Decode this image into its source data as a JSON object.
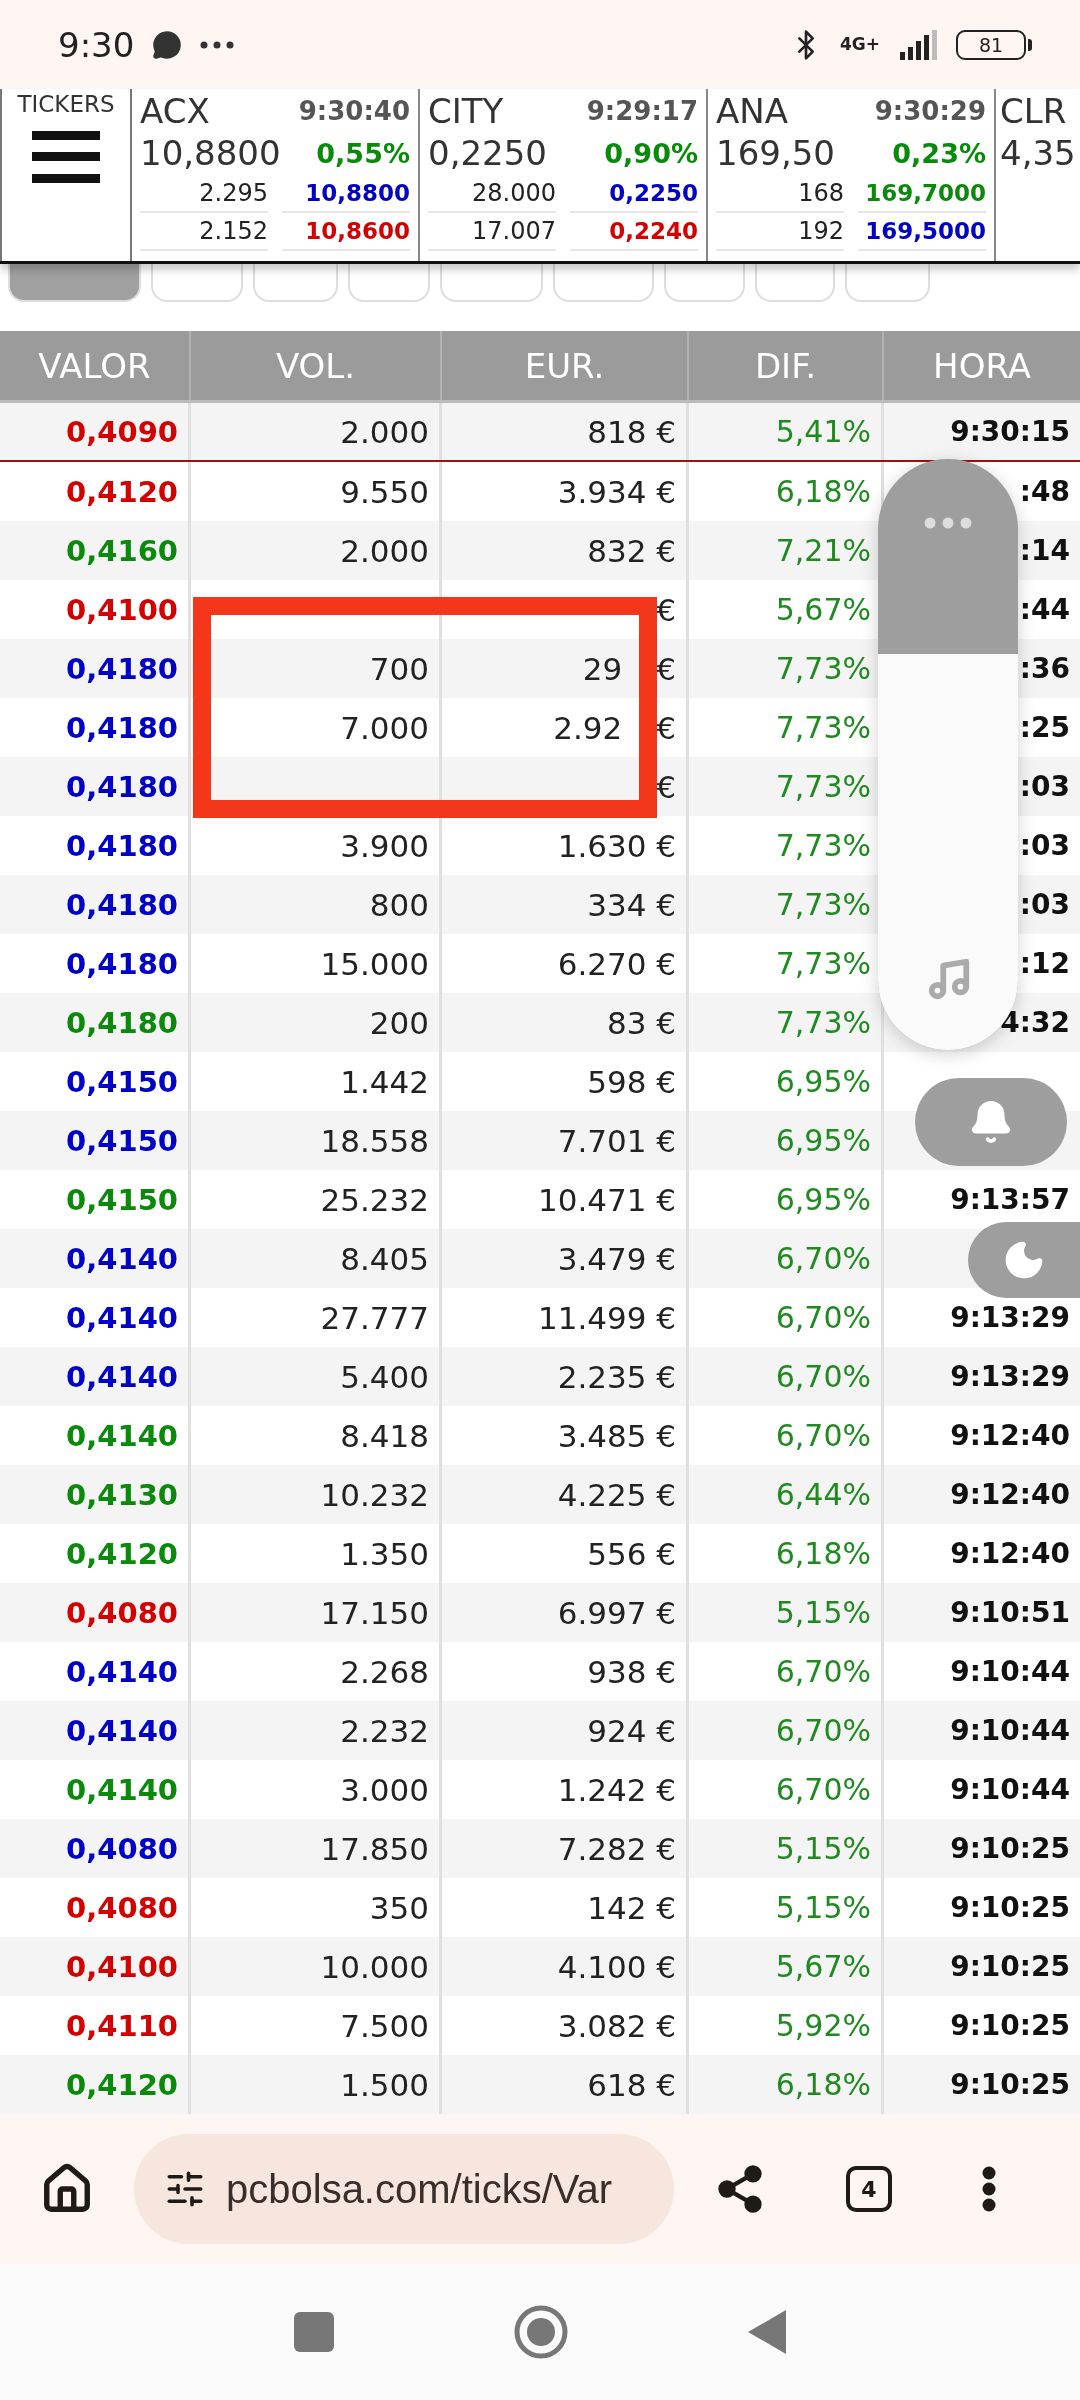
{
  "status_bar": {
    "time": "9:30",
    "network": "4G+",
    "battery": "81"
  },
  "tickers": {
    "label": "TICKERS",
    "items": [
      {
        "symbol": "ACX",
        "time": "9:30:40",
        "price": "10,8800",
        "change": "0,55%",
        "rows": [
          {
            "volume": "2.295",
            "price": "10,8800",
            "color": "#0000c8"
          },
          {
            "volume": "2.152",
            "price": "10,8600",
            "color": "#d40000"
          }
        ]
      },
      {
        "symbol": "CITY",
        "time": "9:29:17",
        "price": "0,2250",
        "change": "0,90%",
        "rows": [
          {
            "volume": "28.000",
            "price": "0,2250",
            "color": "#0000c8"
          },
          {
            "volume": "17.007",
            "price": "0,2240",
            "color": "#d40000"
          }
        ]
      },
      {
        "symbol": "ANA",
        "time": "9:30:29",
        "price": "169,50",
        "change": "0,23%",
        "rows": [
          {
            "volume": "168",
            "price": "169,7000",
            "color": "#0a8a0a"
          },
          {
            "volume": "192",
            "price": "169,5000",
            "color": "#0000c8"
          }
        ]
      },
      {
        "symbol": "CLR",
        "price": "4,35"
      }
    ]
  },
  "filter_tabs": [
    {
      "selected": true
    },
    {
      "selected": false
    },
    {
      "selected": false
    },
    {
      "selected": false
    },
    {
      "selected": false
    },
    {
      "selected": false
    },
    {
      "selected": false
    },
    {
      "selected": false
    },
    {
      "selected": false
    }
  ],
  "table": {
    "columns": [
      "VALOR",
      "VOL.",
      "EUR.",
      "DIF.",
      "HORA"
    ],
    "rows": [
      {
        "valor": "0,4090",
        "color": "#d40000",
        "vol": "2.000",
        "eur": "818 €",
        "dif": "5,41%",
        "hora": "9:30:15",
        "separator": true
      },
      {
        "valor": "0,4120",
        "color": "#d40000",
        "vol": "9.550",
        "eur": "3.934 €",
        "dif": "6,18%",
        "hora": ":48",
        "separator": false
      },
      {
        "valor": "0,4160",
        "color": "#0a8a0a",
        "vol": "2.000",
        "eur": "832 €",
        "dif": "7,21%",
        "hora": ":14",
        "separator": false
      },
      {
        "valor": "0,4100",
        "color": "#d40000",
        "eur": "€",
        "dif": "5,67%",
        "hora": ":44",
        "separator": false
      },
      {
        "valor": "0,4180",
        "color": "#0000c8",
        "vol": "700",
        "eur_fragment": "29",
        "eur": "€",
        "dif": "7,73%",
        "hora": ":36",
        "separator": false
      },
      {
        "valor": "0,4180",
        "color": "#0000c8",
        "vol": "7.000",
        "eur_fragment": "2.92",
        "eur": "€",
        "dif": "7,73%",
        "hora": ":25",
        "separator": false
      },
      {
        "valor": "0,4180",
        "color": "#0000c8",
        "eur": "€",
        "dif": "7,73%",
        "hora": ":03",
        "separator": false
      },
      {
        "valor": "0,4180",
        "color": "#0000c8",
        "vol": "3.900",
        "eur": "1.630 €",
        "dif": "7,73%",
        "hora": ":03",
        "separator": false
      },
      {
        "valor": "0,4180",
        "color": "#0000c8",
        "vol": "800",
        "eur": "334 €",
        "dif": "7,73%",
        "hora": ":03",
        "separator": false
      },
      {
        "valor": "0,4180",
        "color": "#0000c8",
        "vol": "15.000",
        "eur": "6.270 €",
        "dif": "7,73%",
        "hora": ":12",
        "separator": false
      },
      {
        "valor": "0,4180",
        "color": "#0a8a0a",
        "vol": "200",
        "eur": "83 €",
        "dif": "7,73%",
        "hora": "4:32",
        "separator": false
      },
      {
        "valor": "0,4150",
        "color": "#0000c8",
        "vol": "1.442",
        "eur": "598 €",
        "dif": "6,95%",
        "separator": false
      },
      {
        "valor": "0,4150",
        "color": "#0000c8",
        "vol": "18.558",
        "eur": "7.701 €",
        "dif": "6,95%",
        "separator": false
      },
      {
        "valor": "0,4150",
        "color": "#0a8a0a",
        "vol": "25.232",
        "eur": "10.471 €",
        "dif": "6,95%",
        "hora": "9:13:57",
        "separator": false
      },
      {
        "valor": "0,4140",
        "color": "#0000c8",
        "vol": "8.405",
        "eur": "3.479 €",
        "dif": "6,70%",
        "separator": false
      },
      {
        "valor": "0,4140",
        "color": "#0000c8",
        "vol": "27.777",
        "eur": "11.499 €",
        "dif": "6,70%",
        "hora": "9:13:29",
        "separator": false
      },
      {
        "valor": "0,4140",
        "color": "#0000c8",
        "vol": "5.400",
        "eur": "2.235 €",
        "dif": "6,70%",
        "hora": "9:13:29",
        "separator": false
      },
      {
        "valor": "0,4140",
        "color": "#0a8a0a",
        "vol": "8.418",
        "eur": "3.485 €",
        "dif": "6,70%",
        "hora": "9:12:40",
        "separator": false
      },
      {
        "valor": "0,4130",
        "color": "#0a8a0a",
        "vol": "10.232",
        "eur": "4.225 €",
        "dif": "6,44%",
        "hora": "9:12:40",
        "separator": false
      },
      {
        "valor": "0,4120",
        "color": "#0a8a0a",
        "vol": "1.350",
        "eur": "556 €",
        "dif": "6,18%",
        "hora": "9:12:40",
        "separator": false
      },
      {
        "valor": "0,4080",
        "color": "#d40000",
        "vol": "17.150",
        "eur": "6.997 €",
        "dif": "5,15%",
        "hora": "9:10:51",
        "separator": false
      },
      {
        "valor": "0,4140",
        "color": "#0000c8",
        "vol": "2.268",
        "eur": "938 €",
        "dif": "6,70%",
        "hora": "9:10:44",
        "separator": false
      },
      {
        "valor": "0,4140",
        "color": "#0000c8",
        "vol": "2.232",
        "eur": "924 €",
        "dif": "6,70%",
        "hora": "9:10:44",
        "separator": false
      },
      {
        "valor": "0,4140",
        "color": "#0a8a0a",
        "vol": "3.000",
        "eur": "1.242 €",
        "dif": "6,70%",
        "hora": "9:10:44",
        "separator": false
      },
      {
        "valor": "0,4080",
        "color": "#0000c8",
        "vol": "17.850",
        "eur": "7.282 €",
        "dif": "5,15%",
        "hora": "9:10:25",
        "separator": false
      },
      {
        "valor": "0,4080",
        "color": "#d40000",
        "vol": "350",
        "eur": "142 €",
        "dif": "5,15%",
        "hora": "9:10:25",
        "separator": false
      },
      {
        "valor": "0,4100",
        "color": "#d40000",
        "vol": "10.000",
        "eur": "4.100 €",
        "dif": "5,67%",
        "hora": "9:10:25",
        "separator": false
      },
      {
        "valor": "0,4110",
        "color": "#d40000",
        "vol": "7.500",
        "eur": "3.082 €",
        "dif": "5,92%",
        "hora": "9:10:25",
        "separator": false
      },
      {
        "valor": "0,4120",
        "color": "#0a8a0a",
        "vol": "1.500",
        "eur": "618 €",
        "dif": "6,18%",
        "hora": "9:10:25",
        "separator": false
      }
    ]
  },
  "volume_panel": {
    "level": 0.67
  },
  "browser": {
    "url": "pcbolsa.com/ticks/Var",
    "tab_count": "4"
  }
}
